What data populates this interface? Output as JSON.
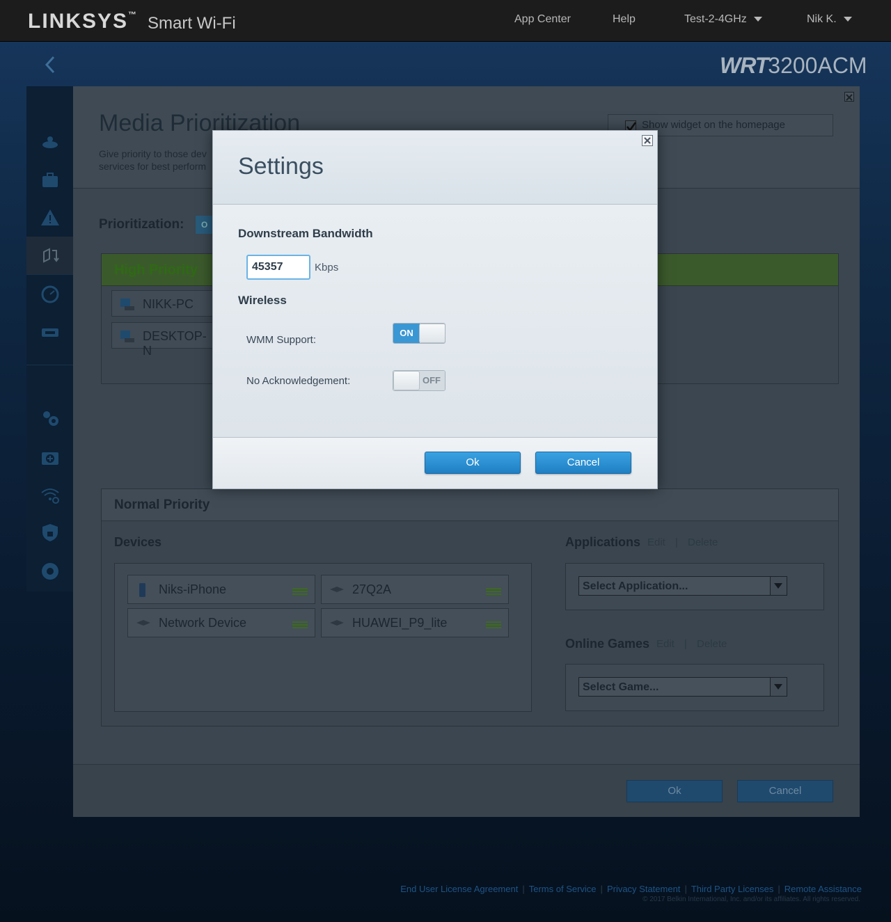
{
  "header": {
    "brand": "LINKSYS",
    "brand_tm": "™",
    "brand_sub": "Smart Wi-Fi",
    "nav": {
      "app_center": "App Center",
      "help": "Help",
      "network": "Test-2-4GHz",
      "user": "Nik K."
    }
  },
  "model": {
    "prefix": "WRT",
    "number": "3200ACM"
  },
  "page": {
    "title": "Media Prioritization",
    "description_line1": "Give priority to those dev",
    "description_line2": "services for best perform",
    "show_widget_label": "Show widget on the homepage",
    "show_widget_checked": true,
    "prioritization_label": "Prioritization:",
    "prioritization_toggle": "O"
  },
  "high_priority": {
    "title": "High Priority",
    "devices": [
      "NIKK-PC",
      "DESKTOP-N"
    ]
  },
  "normal_priority": {
    "title": "Normal Priority",
    "devices_label": "Devices",
    "devices": [
      {
        "name": "Niks-iPhone",
        "icon": "phone-icon"
      },
      {
        "name": "27Q2A",
        "icon": "network-device-icon"
      },
      {
        "name": "Network Device",
        "icon": "network-device-icon"
      },
      {
        "name": "HUAWEI_P9_lite",
        "icon": "network-device-icon"
      }
    ],
    "applications_label": "Applications",
    "online_games_label": "Online Games",
    "edit": "Edit",
    "separator": "|",
    "delete": "Delete",
    "select_application": "Select Application...",
    "select_game": "Select Game..."
  },
  "panel_footer": {
    "ok": "Ok",
    "cancel": "Cancel"
  },
  "footer": {
    "eula": "End User License Agreement",
    "terms": "Terms of Service",
    "privacy": "Privacy Statement",
    "third_party": "Third Party Licenses",
    "remote": "Remote Assistance",
    "separator": "|",
    "copyright": "© 2017 Belkin International, Inc. and/or its affiliates. All rights reserved."
  },
  "modal": {
    "title": "Settings",
    "downstream_label": "Downstream Bandwidth",
    "bandwidth_value": "45357",
    "bandwidth_unit": "Kbps",
    "wireless_label": "Wireless",
    "wmm_label": "WMM Support:",
    "wmm_state": "ON",
    "noack_label": "No Acknowledgement:",
    "noack_state": "OFF",
    "ok": "Ok",
    "cancel": "Cancel"
  },
  "colors": {
    "accent_blue": "#3a97d4",
    "high_priority_green": "#2f6a14",
    "footer_link": "#1d5487"
  }
}
